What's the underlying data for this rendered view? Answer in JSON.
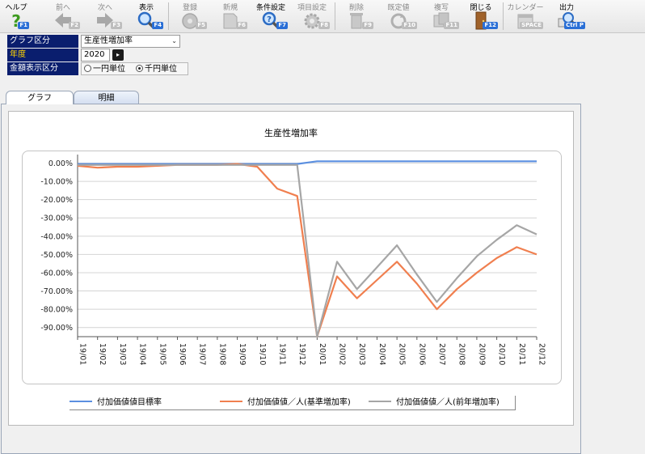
{
  "toolbar": {
    "help": {
      "label": "ヘルプ",
      "key": "F1"
    },
    "prev": {
      "label": "前へ",
      "key": "F2"
    },
    "next": {
      "label": "次へ",
      "key": "F3"
    },
    "show": {
      "label": "表示",
      "key": "F4"
    },
    "register": {
      "label": "登録",
      "key": "F5"
    },
    "new": {
      "label": "新規",
      "key": "F6"
    },
    "condition": {
      "label": "条件設定",
      "key": "F7"
    },
    "item": {
      "label": "項目設定",
      "key": "F8"
    },
    "delete": {
      "label": "削除",
      "key": "F9"
    },
    "default": {
      "label": "既定値",
      "key": "F10"
    },
    "copy": {
      "label": "複写",
      "key": "F11"
    },
    "close": {
      "label": "閉じる",
      "key": "F12"
    },
    "calendar": {
      "label": "カレンダー",
      "key": "SPACE"
    },
    "output": {
      "label": "出力",
      "key": "Ctrl P"
    }
  },
  "form": {
    "graph_label": "グラフ区分",
    "graph_value": "生産性増加率",
    "year_label": "年度",
    "year_value": "2020",
    "amount_label": "金額表示区分",
    "radio_yen": "一円単位",
    "radio_thousand": "千円単位"
  },
  "tabs": {
    "graph": "グラフ",
    "detail": "明細"
  },
  "colors": {
    "blue": "#5b8fe0",
    "orange": "#f07f4f",
    "gray": "#a6a6a6",
    "header": "#0a1e6e"
  },
  "chart_data": {
    "type": "line",
    "title": "生産性増加率",
    "categories": [
      "19/01",
      "19/02",
      "19/03",
      "19/04",
      "19/05",
      "19/06",
      "19/07",
      "19/08",
      "19/09",
      "19/10",
      "19/11",
      "19/12",
      "20/01",
      "20/02",
      "20/03",
      "20/04",
      "20/05",
      "20/06",
      "20/07",
      "20/08",
      "20/09",
      "20/10",
      "20/11",
      "20/12"
    ],
    "y_ticks": [
      "0.00%",
      "-10.00%",
      "-20.00%",
      "-30.00%",
      "-40.00%",
      "-50.00%",
      "-60.00%",
      "-70.00%",
      "-80.00%",
      "-90.00%"
    ],
    "ylim": [
      -95,
      2
    ],
    "series": [
      {
        "name": "付加価値値目標率",
        "color": "#5b8fe0",
        "values": [
          -0.5,
          -0.5,
          -0.5,
          -0.5,
          -0.5,
          -0.5,
          -0.5,
          -0.5,
          -0.5,
          -0.5,
          -0.5,
          -0.5,
          1,
          1,
          1,
          1,
          1,
          1,
          1,
          1,
          1,
          1,
          1,
          1
        ]
      },
      {
        "name": "付加価値値／人(基準増加率)",
        "color": "#f07f4f",
        "values": [
          -1.5,
          -2.5,
          -2,
          -2,
          -1.5,
          -1,
          -1,
          -1,
          -0.5,
          -2,
          -14,
          -18,
          -95,
          -62,
          -74,
          -64,
          -54,
          -66,
          -80,
          -69,
          -60,
          -52,
          -46,
          -50
        ]
      },
      {
        "name": "付加価値値／人(前年増加率)",
        "color": "#a6a6a6",
        "values": [
          -1,
          -1,
          -1,
          -1,
          -1,
          -1,
          -1,
          -1,
          -1,
          -1,
          -1,
          -1,
          -95,
          -54,
          -69,
          -57,
          -45,
          -61,
          -76,
          -63,
          -51,
          -42,
          -34,
          -39
        ]
      }
    ],
    "legend_position": "bottom",
    "grid": true
  }
}
